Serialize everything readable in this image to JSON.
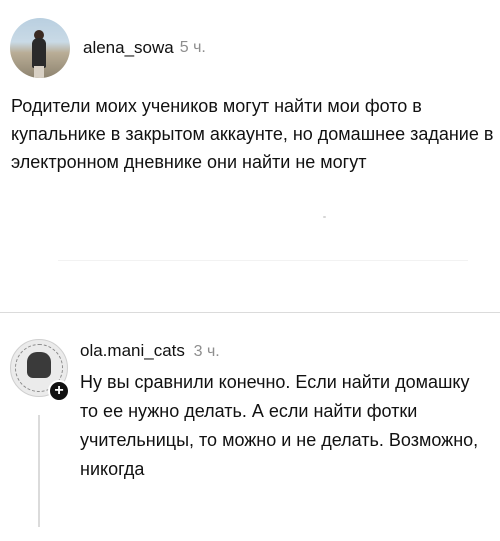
{
  "post": {
    "username": "alena_sowa",
    "time": "5 ч.",
    "text": "Родители моих учеников могут найти мои фото в купальнике в закрытом аккаунте, но домашнее задание в электронном дневнике они найти не могут"
  },
  "comment": {
    "username": "ola.mani_cats",
    "time": "3 ч.",
    "text": "Ну вы сравнили конечно. Если найти домашку то ее нужно делать. А если найти фотки учительницы, то можно и не делать. Возможно, никогда",
    "plus_icon": "+"
  }
}
